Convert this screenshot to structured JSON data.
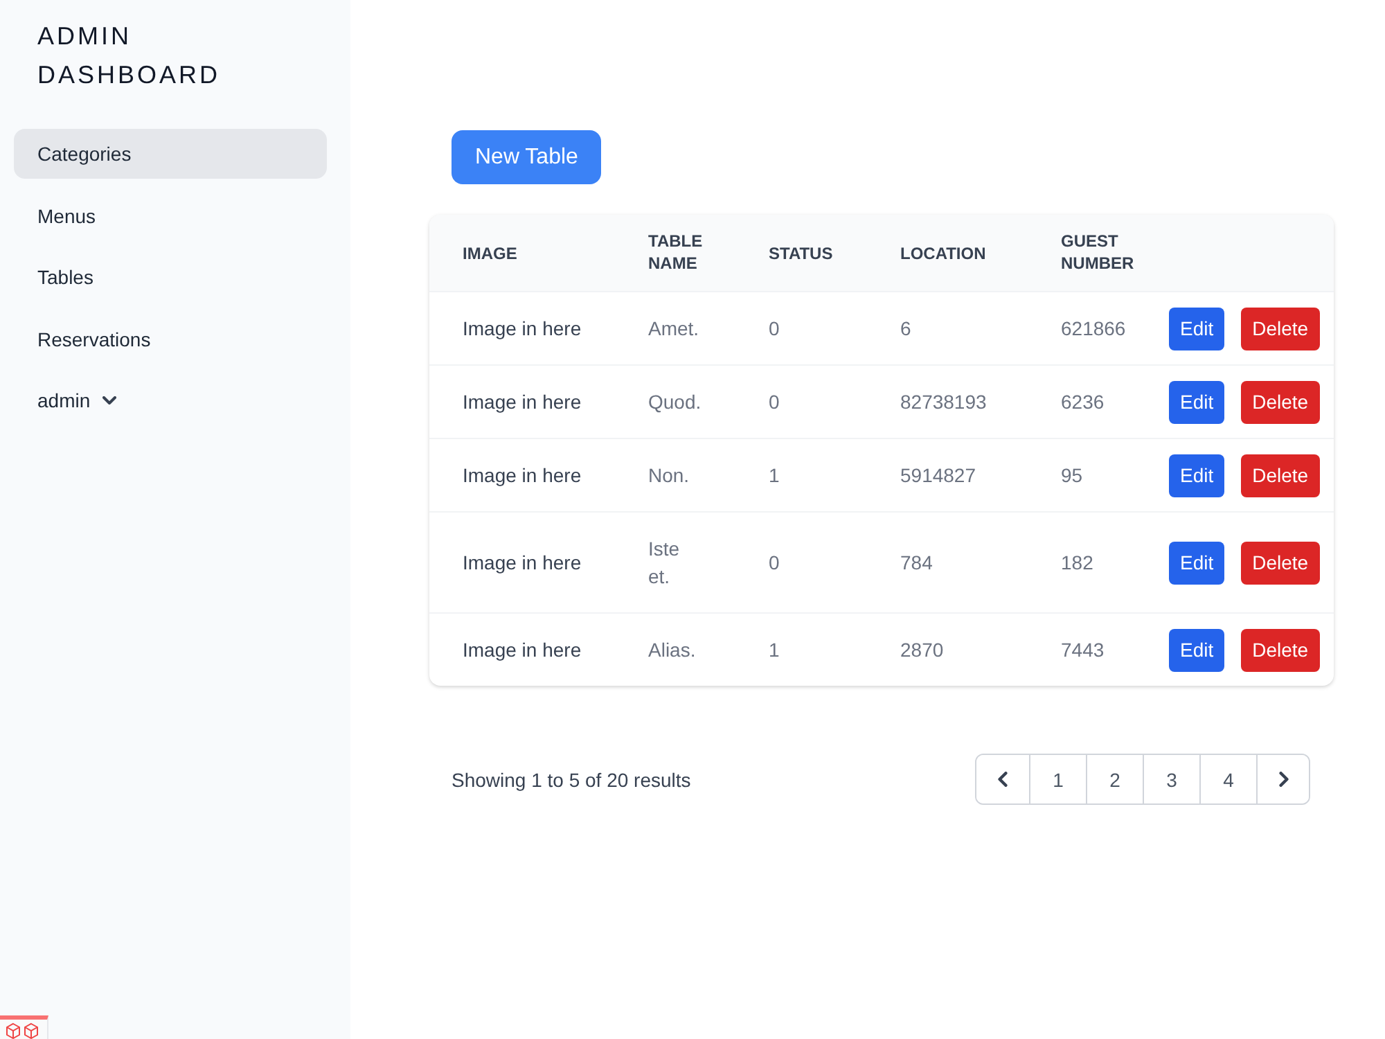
{
  "sidebar": {
    "title": "ADMIN DASHBOARD",
    "items": [
      {
        "label": "Categories",
        "kind": "link",
        "selected": true
      },
      {
        "label": "Menus",
        "kind": "link",
        "selected": false
      },
      {
        "label": "Tables",
        "kind": "link",
        "selected": false
      },
      {
        "label": "Reservations",
        "kind": "link",
        "selected": false
      },
      {
        "label": "admin",
        "kind": "dropdown",
        "selected": false
      }
    ]
  },
  "main": {
    "new_button": "New Table",
    "table": {
      "columns": [
        "IMAGE",
        "TABLE NAME",
        "STATUS",
        "LOCATION",
        "GUEST NUMBER"
      ],
      "rows": [
        {
          "cells": [
            "Image in here",
            "Amet.",
            "0",
            "6",
            "621866"
          ],
          "actions": [
            {
              "label": "Edit",
              "kind": "edit"
            },
            {
              "label": "Delete",
              "kind": "delete"
            }
          ]
        },
        {
          "cells": [
            "Image in here",
            "Quod.",
            "0",
            "82738193",
            "6236"
          ],
          "actions": [
            {
              "label": "Edit",
              "kind": "edit"
            },
            {
              "label": "Delete",
              "kind": "delete"
            }
          ]
        },
        {
          "cells": [
            "Image in here",
            "Non.",
            "1",
            "5914827",
            "95"
          ],
          "actions": [
            {
              "label": "Edit",
              "kind": "edit"
            },
            {
              "label": "Delete",
              "kind": "delete"
            }
          ]
        },
        {
          "cells": [
            "Image in here",
            "Iste et.",
            "0",
            "784",
            "182"
          ],
          "actions": [
            {
              "label": "Edit",
              "kind": "edit"
            },
            {
              "label": "Delete",
              "kind": "delete"
            }
          ]
        },
        {
          "cells": [
            "Image in here",
            "Alias.",
            "1",
            "2870",
            "7443"
          ],
          "actions": [
            {
              "label": "Edit",
              "kind": "edit"
            },
            {
              "label": "Delete",
              "kind": "delete"
            }
          ]
        }
      ]
    },
    "pagination": {
      "summary": "Showing 1 to 5 of 20 results",
      "pages": [
        "1",
        "2",
        "3",
        "4"
      ]
    }
  }
}
